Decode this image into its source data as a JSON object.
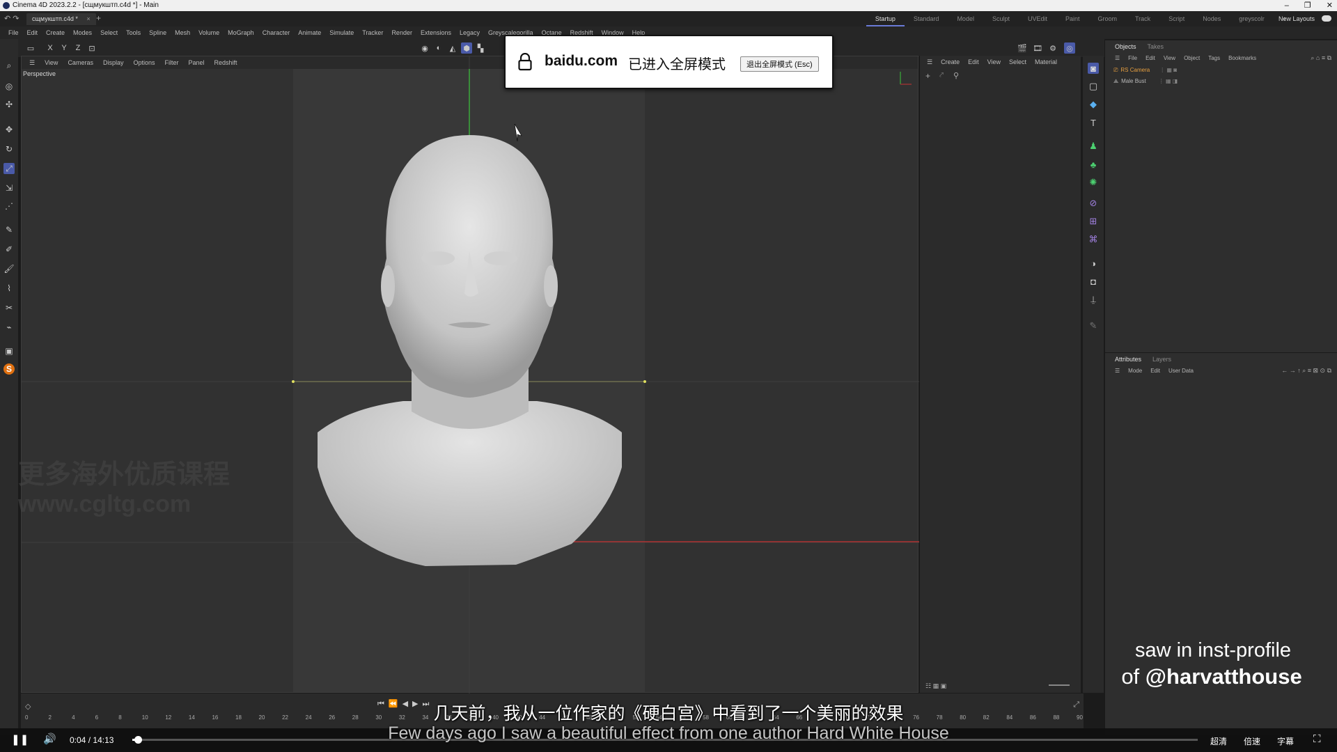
{
  "window": {
    "title": "Cinema 4D 2023.2.2 - [сщмукштп.c4d *] - Main",
    "buttons": [
      "–",
      "❐",
      "✕"
    ]
  },
  "document": {
    "tab_label": "сщмукштп.c4d *",
    "close": "×",
    "new_tab": "+"
  },
  "layouts": {
    "items": [
      "Startup",
      "Standard",
      "Model",
      "Sculpt",
      "UVEdit",
      "Paint",
      "Groom",
      "Track",
      "Script",
      "Nodes",
      "greyscolr"
    ],
    "add": "+",
    "new_layouts": "New Layouts"
  },
  "menu": [
    "File",
    "Edit",
    "Create",
    "Modes",
    "Select",
    "Tools",
    "Spline",
    "Mesh",
    "Volume",
    "MoGraph",
    "Character",
    "Animate",
    "Simulate",
    "Tracker",
    "Render",
    "Extensions",
    "Legacy",
    "Greyscalegorilla",
    "Octane",
    "Redshift",
    "Window",
    "Help"
  ],
  "axis_toggles": [
    "X",
    "Y",
    "Z"
  ],
  "viewport": {
    "menu": [
      "View",
      "Cameras",
      "Display",
      "Options",
      "Filter",
      "Panel",
      "Redshift"
    ],
    "label": "Perspective"
  },
  "content_browser": {
    "menu": [
      "Create",
      "Edit",
      "View",
      "Select",
      "Material"
    ]
  },
  "objects_panel": {
    "tabs": [
      "Objects",
      "Takes"
    ],
    "menu": [
      "File",
      "Edit",
      "View",
      "Object",
      "Tags",
      "Bookmarks"
    ],
    "items": [
      {
        "name": "RS Camera",
        "color": "#e8a040"
      },
      {
        "name": "Male Bust",
        "color": "#b8b8b8"
      }
    ]
  },
  "attributes_panel": {
    "tabs": [
      "Attributes",
      "Layers"
    ],
    "menu": [
      "Mode",
      "Edit",
      "User Data"
    ]
  },
  "timeline": {
    "ticks": [
      "0",
      "2",
      "4",
      "6",
      "8",
      "10",
      "12",
      "14",
      "16",
      "18",
      "20",
      "22",
      "24",
      "26",
      "28",
      "30",
      "32",
      "34",
      "36",
      "38",
      "40",
      "42",
      "44",
      "46",
      "48",
      "50",
      "52",
      "54",
      "56",
      "58",
      "60",
      "62",
      "64",
      "66",
      "68",
      "70",
      "72",
      "74",
      "76",
      "78",
      "80",
      "82",
      "84",
      "86",
      "88",
      "90"
    ]
  },
  "fullscreen_notice": {
    "domain": "baidu.com",
    "message": "已进入全屏模式",
    "exit_button": "退出全屏模式 (Esc)"
  },
  "player": {
    "current_time": "0:04",
    "separator": "/",
    "total_time": "14:13",
    "progress": 0.005,
    "quality": "超清",
    "speed": "倍速",
    "subtitles": "字幕"
  },
  "subtitles": {
    "cn": "几天前，我从一位作家的《硬白宫》中看到了一个美丽的效果",
    "en": "Few days ago I saw a beautiful effect from one author Hard White House"
  },
  "watermark": {
    "line1": "更多海外优质课程",
    "line2": "www.cgltg.com"
  },
  "credit": {
    "line1": "saw in inst-profile",
    "of": "of",
    "handle": "@harvatthouse"
  },
  "colors": {
    "accent": "#4a5aa8",
    "tab_underline": "#6a7ad8",
    "axis_x": "#c83232",
    "axis_y": "#3cc83c"
  }
}
